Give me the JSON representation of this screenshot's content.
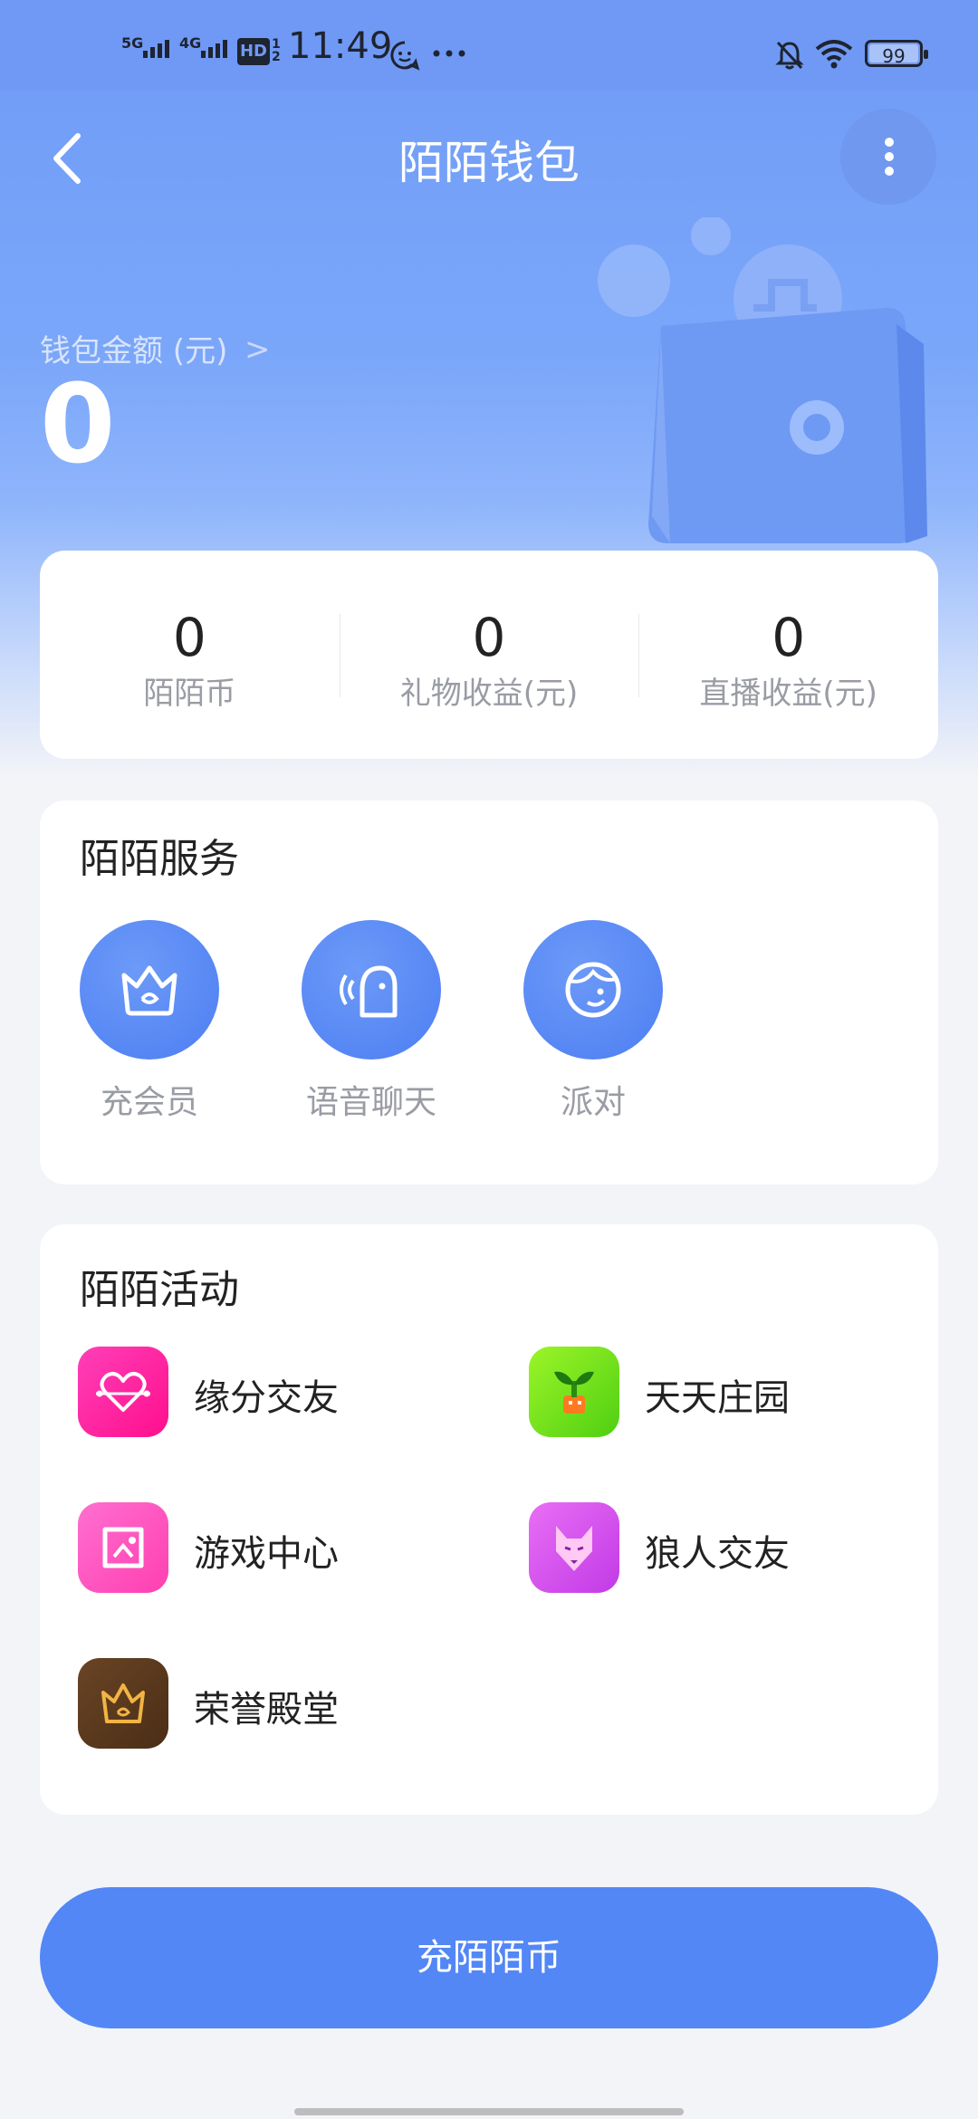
{
  "status_bar": {
    "time": "11:49",
    "signal_1": "5G",
    "signal_2": "4G",
    "hd": "HD",
    "hd_sub": "1 2",
    "battery": "99",
    "icons": [
      "bell-off-icon",
      "wifi-icon",
      "battery-icon",
      "chat-bubble-icon",
      "more-dots-icon"
    ]
  },
  "header": {
    "title": "陌陌钱包",
    "back_icon": "chevron-left-icon",
    "menu_icon": "vertical-dots-icon"
  },
  "wallet": {
    "label": "钱包金额 (元)",
    "chevron": ">",
    "amount": "0"
  },
  "stats": [
    {
      "value": "0",
      "label": "陌陌币"
    },
    {
      "value": "0",
      "label": "礼物收益(元)"
    },
    {
      "value": "0",
      "label": "直播收益(元)"
    }
  ],
  "services": {
    "title": "陌陌服务",
    "items": [
      {
        "label": "充会员",
        "icon": "crown-icon"
      },
      {
        "label": "语音聊天",
        "icon": "voice-chat-icon"
      },
      {
        "label": "派对",
        "icon": "party-face-icon"
      }
    ]
  },
  "activities": {
    "title": "陌陌活动",
    "items": [
      {
        "label": "缘分交友",
        "icon": "heart-link-icon",
        "color": "#ff1fa5"
      },
      {
        "label": "天天庄园",
        "icon": "sprout-icon",
        "color": "#6ee11c"
      },
      {
        "label": "游戏中心",
        "icon": "game-controller-icon",
        "color": "#ff4fbf"
      },
      {
        "label": "狼人交友",
        "icon": "wolf-icon",
        "color": "#d84ff0"
      },
      {
        "label": "荣誉殿堂",
        "icon": "crown-icon",
        "color": "#5b3a1e"
      }
    ]
  },
  "recharge_button": "充陌陌币",
  "colors": {
    "accent": "#5287f5",
    "header_bg": "#6f99f4",
    "page_bg": "#f3f4f7"
  }
}
